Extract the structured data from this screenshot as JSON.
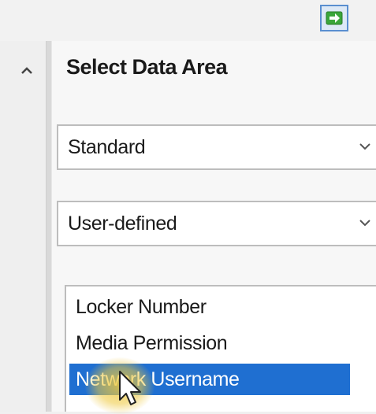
{
  "panel": {
    "title": "Select Data Area"
  },
  "combos": [
    {
      "value": "Standard"
    },
    {
      "value": "User-defined"
    }
  ],
  "fields_list": {
    "items": [
      {
        "label": "Locker Number",
        "selected": false
      },
      {
        "label": "Media Permission",
        "selected": false
      },
      {
        "label": "Network Username",
        "selected": true
      }
    ]
  },
  "colors": {
    "selection": "#1f6fd1",
    "go_button_border": "#5a8fd0",
    "go_arrow": "#3aa63a"
  },
  "icons": {
    "go": "green-arrow-right-icon",
    "collapse": "chevron-up-icon",
    "dropdown": "chevron-down-icon",
    "cursor": "mouse-pointer-icon"
  }
}
